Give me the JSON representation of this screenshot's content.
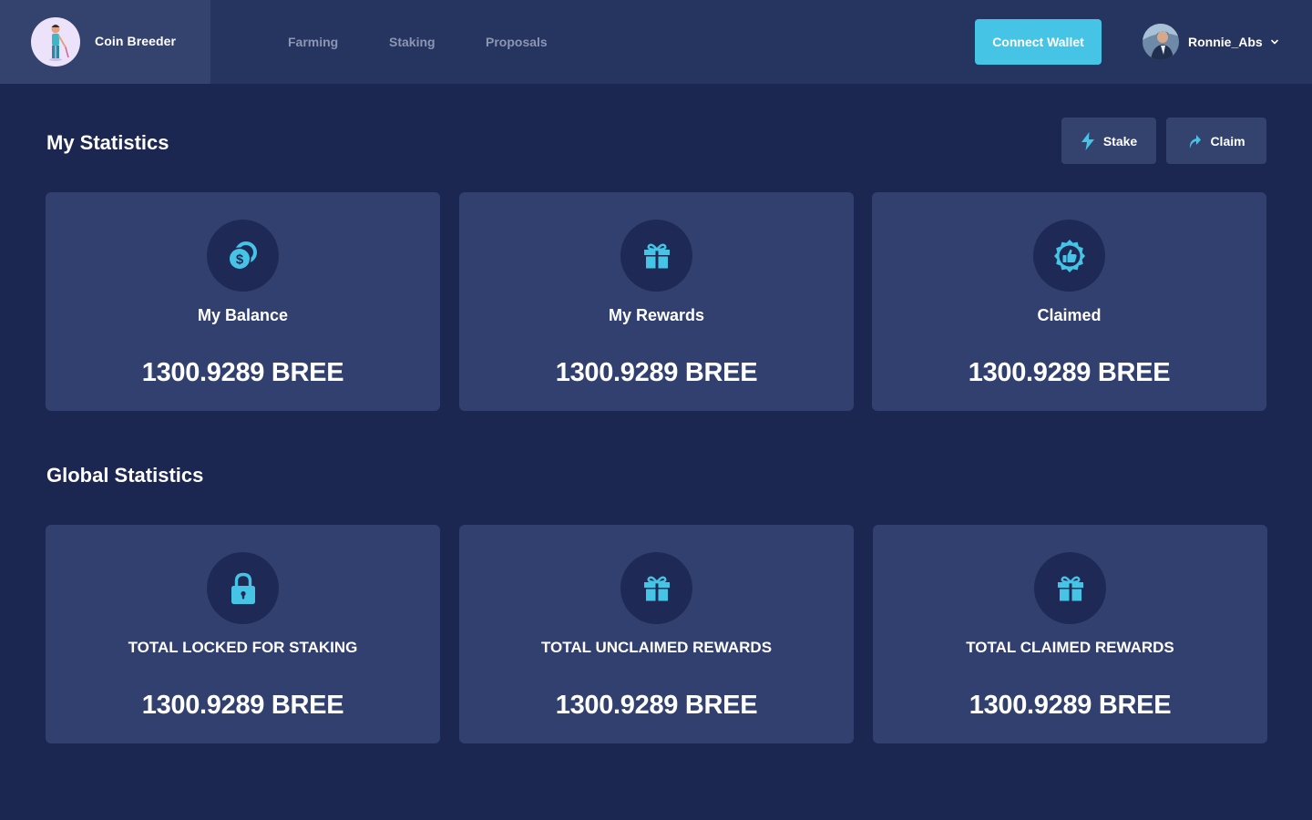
{
  "app": {
    "name": "Coin Breeder"
  },
  "nav": {
    "items": [
      {
        "label": "Farming"
      },
      {
        "label": "Staking"
      },
      {
        "label": "Proposals"
      }
    ]
  },
  "header": {
    "connect_label": "Connect Wallet",
    "username": "Ronnie_Abs",
    "accent": "#45c4e6"
  },
  "my_stats": {
    "title": "My Statistics",
    "stake_label": "Stake",
    "claim_label": "Claim",
    "cards": [
      {
        "icon": "coins-icon",
        "label": "My Balance",
        "value": "1300.9289 BREE"
      },
      {
        "icon": "gift-icon",
        "label": "My Rewards",
        "value": "1300.9289 BREE"
      },
      {
        "icon": "thumbs-up-badge-icon",
        "label": "Claimed",
        "value": "1300.9289 BREE"
      }
    ]
  },
  "global_stats": {
    "title": "Global Statistics",
    "cards": [
      {
        "icon": "lock-icon",
        "label": "TOTAL LOCKED FOR STAKING",
        "value": "1300.9289 BREE"
      },
      {
        "icon": "gift-icon",
        "label": "TOTAL UNCLAIMED REWARDS",
        "value": "1300.9289 BREE"
      },
      {
        "icon": "gift-icon",
        "label": "TOTAL CLAIMED REWARDS",
        "value": "1300.9289 BREE"
      }
    ]
  }
}
